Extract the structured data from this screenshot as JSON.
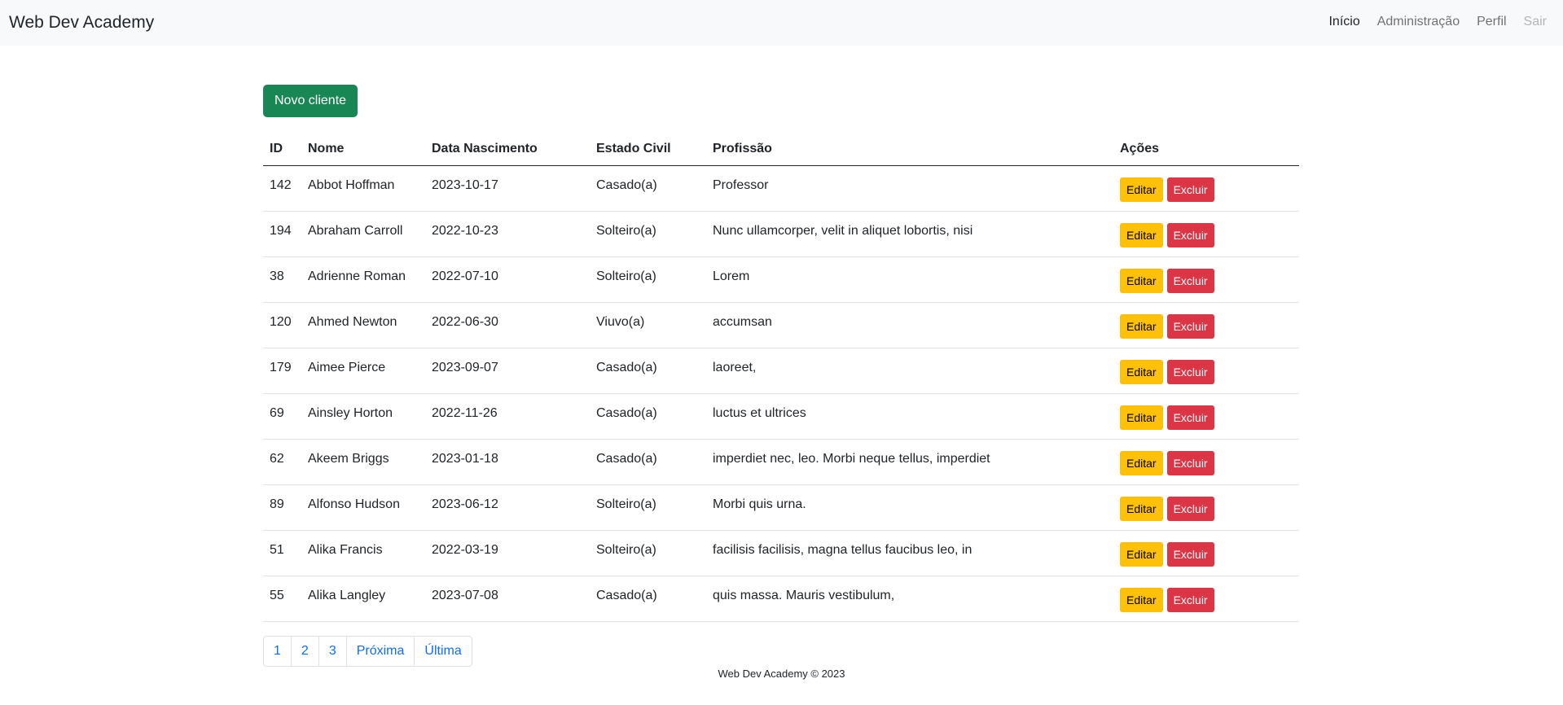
{
  "navbar": {
    "brand": "Web Dev Academy",
    "links": [
      {
        "label": "Início",
        "state": "active"
      },
      {
        "label": "Administração",
        "state": "normal"
      },
      {
        "label": "Perfil",
        "state": "normal"
      },
      {
        "label": "Sair",
        "state": "disabled"
      }
    ]
  },
  "new_button": "Novo cliente",
  "table": {
    "headers": [
      "ID",
      "Nome",
      "Data Nascimento",
      "Estado Civil",
      "Profissão",
      "Ações"
    ],
    "edit_label": "Editar",
    "delete_label": "Excluir",
    "rows": [
      {
        "id": "142",
        "nome": "Abbot Hoffman",
        "nascimento": "2023-10-17",
        "estado": "Casado(a)",
        "profissao": "Professor"
      },
      {
        "id": "194",
        "nome": "Abraham Carroll",
        "nascimento": "2022-10-23",
        "estado": "Solteiro(a)",
        "profissao": "Nunc ullamcorper, velit in aliquet lobortis, nisi"
      },
      {
        "id": "38",
        "nome": "Adrienne Roman",
        "nascimento": "2022-07-10",
        "estado": "Solteiro(a)",
        "profissao": "Lorem"
      },
      {
        "id": "120",
        "nome": "Ahmed Newton",
        "nascimento": "2022-06-30",
        "estado": "Viuvo(a)",
        "profissao": "accumsan"
      },
      {
        "id": "179",
        "nome": "Aimee Pierce",
        "nascimento": "2023-09-07",
        "estado": "Casado(a)",
        "profissao": "laoreet,"
      },
      {
        "id": "69",
        "nome": "Ainsley Horton",
        "nascimento": "2022-11-26",
        "estado": "Casado(a)",
        "profissao": "luctus et ultrices"
      },
      {
        "id": "62",
        "nome": "Akeem Briggs",
        "nascimento": "2023-01-18",
        "estado": "Casado(a)",
        "profissao": "imperdiet nec, leo. Morbi neque tellus, imperdiet"
      },
      {
        "id": "89",
        "nome": "Alfonso Hudson",
        "nascimento": "2023-06-12",
        "estado": "Solteiro(a)",
        "profissao": "Morbi quis urna."
      },
      {
        "id": "51",
        "nome": "Alika Francis",
        "nascimento": "2022-03-19",
        "estado": "Solteiro(a)",
        "profissao": "facilisis facilisis, magna tellus faucibus leo, in"
      },
      {
        "id": "55",
        "nome": "Alika Langley",
        "nascimento": "2023-07-08",
        "estado": "Casado(a)",
        "profissao": "quis massa. Mauris vestibulum,"
      }
    ]
  },
  "pagination": [
    "1",
    "2",
    "3",
    "Próxima",
    "Última"
  ],
  "footer": "Web Dev Academy © 2023",
  "colors": {
    "navbar_bg": "#f8f9fa",
    "success": "#198754",
    "warning": "#ffc107",
    "danger": "#dc3545",
    "link": "#0d6efd"
  }
}
